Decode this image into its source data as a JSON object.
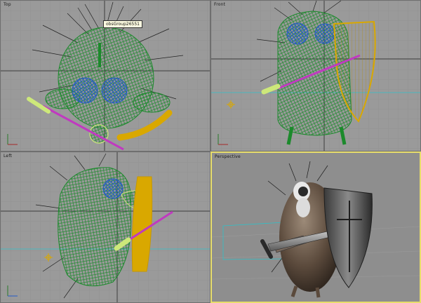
{
  "viewports": {
    "top": {
      "label": "Top"
    },
    "front": {
      "label": "Front"
    },
    "left": {
      "label": "Left"
    },
    "persp": {
      "label": "Perspective"
    }
  },
  "tooltip": {
    "text": "obsGroup26551"
  },
  "colors": {
    "viewport_bg": "#9a9a9a",
    "grid_line": "#8c8c8c",
    "axis_line": "#3c3c3c",
    "active_border": "#e7dd6b",
    "wire_green": "#1c8a2c",
    "wire_blue": "#2459c8",
    "wire_magenta": "#c03ac0",
    "wire_yellow": "#d9a800",
    "wire_lime": "#cde87a",
    "cyan_line": "#2fc0c8",
    "shaded_bg": "#8e8e8e"
  }
}
